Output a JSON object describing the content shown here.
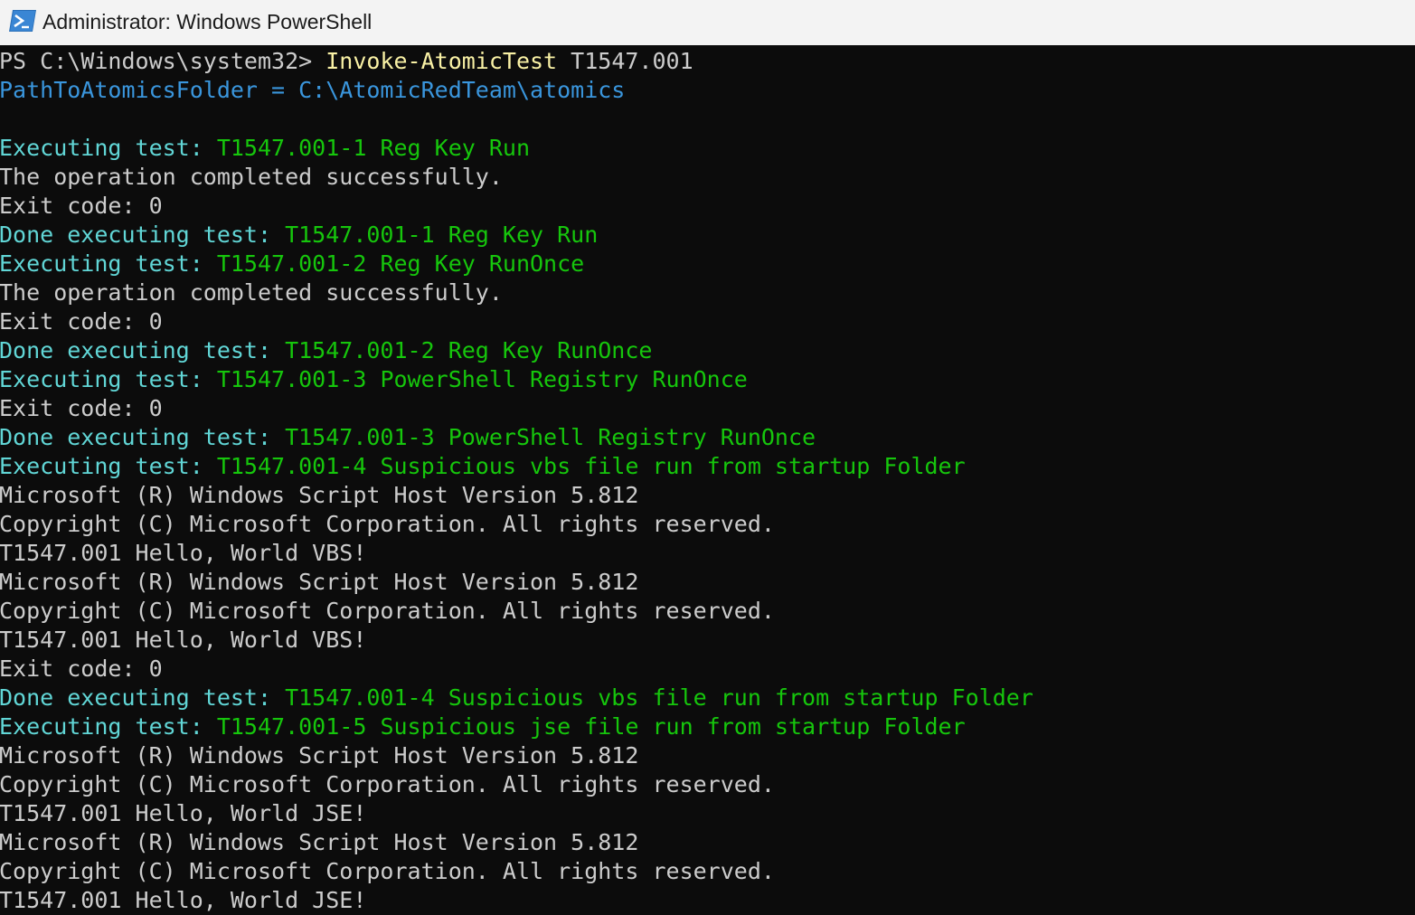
{
  "window": {
    "title": "Administrator: Windows PowerShell",
    "icon": "powershell-icon"
  },
  "colors": {
    "background": "#0c0c0c",
    "text": "#cccccc",
    "command": "#f9f1a5",
    "info": "#3a96dd",
    "status_label": "#61d6d6",
    "test_name": "#16c60c"
  },
  "console": {
    "prompt": "PS C:\\Windows\\system32> ",
    "command_name": "Invoke-AtomicTest",
    "command_args": " T1547.001",
    "path_line": "PathToAtomicsFolder = C:\\AtomicRedTeam\\atomics",
    "lines": [
      {
        "label": "Executing test: ",
        "value": "T1547.001-1 Reg Key Run"
      },
      {
        "text": "The operation completed successfully."
      },
      {
        "text": "Exit code: 0"
      },
      {
        "label": "Done executing test: ",
        "value": "T1547.001-1 Reg Key Run"
      },
      {
        "label": "Executing test: ",
        "value": "T1547.001-2 Reg Key RunOnce"
      },
      {
        "text": "The operation completed successfully."
      },
      {
        "text": "Exit code: 0"
      },
      {
        "label": "Done executing test: ",
        "value": "T1547.001-2 Reg Key RunOnce"
      },
      {
        "label": "Executing test: ",
        "value": "T1547.001-3 PowerShell Registry RunOnce"
      },
      {
        "text": "Exit code: 0"
      },
      {
        "label": "Done executing test: ",
        "value": "T1547.001-3 PowerShell Registry RunOnce"
      },
      {
        "label": "Executing test: ",
        "value": "T1547.001-4 Suspicious vbs file run from startup Folder"
      },
      {
        "text": "Microsoft (R) Windows Script Host Version 5.812"
      },
      {
        "text": "Copyright (C) Microsoft Corporation. All rights reserved."
      },
      {
        "text": "T1547.001 Hello, World VBS!"
      },
      {
        "text": "Microsoft (R) Windows Script Host Version 5.812"
      },
      {
        "text": "Copyright (C) Microsoft Corporation. All rights reserved."
      },
      {
        "text": "T1547.001 Hello, World VBS!"
      },
      {
        "text": "Exit code: 0"
      },
      {
        "label": "Done executing test: ",
        "value": "T1547.001-4 Suspicious vbs file run from startup Folder"
      },
      {
        "label": "Executing test: ",
        "value": "T1547.001-5 Suspicious jse file run from startup Folder"
      },
      {
        "text": "Microsoft (R) Windows Script Host Version 5.812"
      },
      {
        "text": "Copyright (C) Microsoft Corporation. All rights reserved."
      },
      {
        "text": "T1547.001 Hello, World JSE!"
      },
      {
        "text": "Microsoft (R) Windows Script Host Version 5.812"
      },
      {
        "text": "Copyright (C) Microsoft Corporation. All rights reserved."
      },
      {
        "text": "T1547.001 Hello, World JSE!"
      }
    ]
  }
}
